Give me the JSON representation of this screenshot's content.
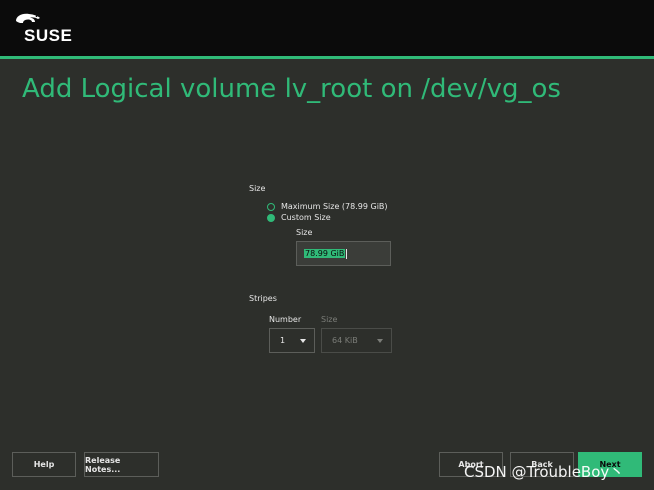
{
  "header": {
    "logo_text": "SUSE"
  },
  "page": {
    "title": "Add Logical volume lv_root on /dev/vg_os"
  },
  "size_section": {
    "label": "Size",
    "options": [
      {
        "label": "Maximum Size (78.99 GiB)",
        "selected": false
      },
      {
        "label": "Custom Size",
        "selected": true
      }
    ],
    "custom_size_label": "Size",
    "custom_size_value": "78.99 GiB"
  },
  "stripes_section": {
    "label": "Stripes",
    "number_label": "Number",
    "number_value": "1",
    "size_label": "Size",
    "size_value": "64 KiB"
  },
  "footer": {
    "help_label": "Help",
    "release_notes_label": "Release Notes...",
    "abort_label": "Abort",
    "back_label": "Back",
    "next_label": "Next"
  },
  "watermark": "CSDN @TroubleBoy丶",
  "colors": {
    "accent": "#30ba78",
    "background": "#2d2f2b",
    "header": "#0b0b0b"
  }
}
